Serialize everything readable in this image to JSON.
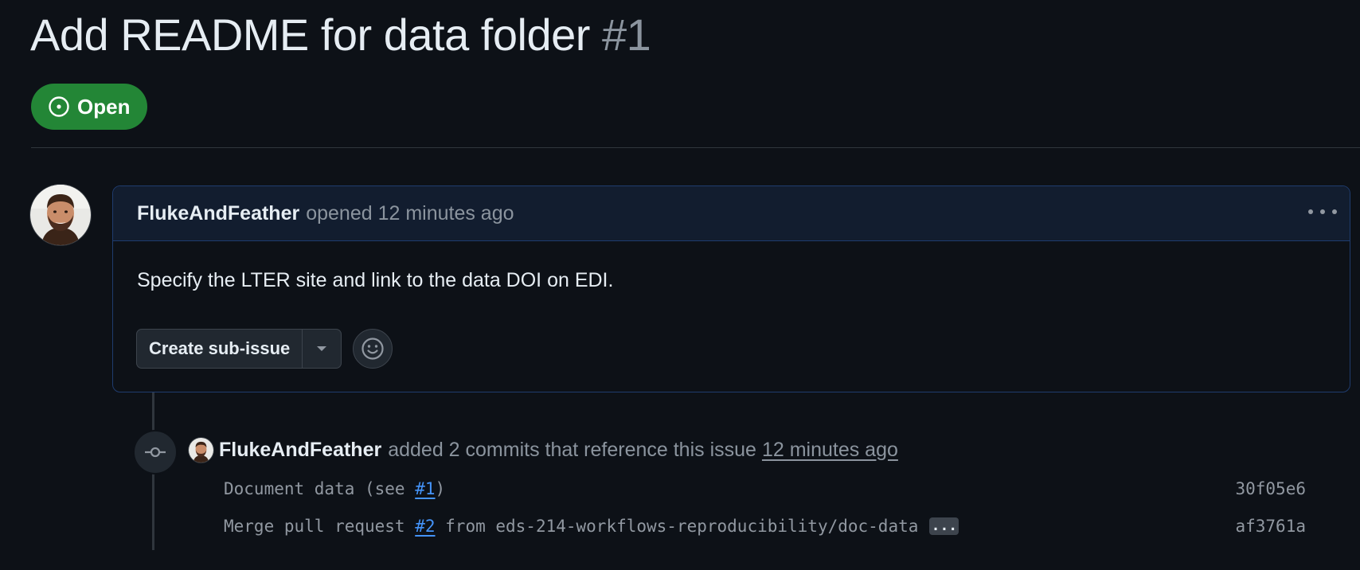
{
  "issue": {
    "title": "Add README for data folder",
    "number": "#1",
    "state": "Open"
  },
  "comment": {
    "author": "FlukeAndFeather",
    "meta": "opened 12 minutes ago",
    "body": "Specify the LTER site and link to the data DOI on EDI.",
    "create_sub_issue_label": "Create sub-issue"
  },
  "timeline": {
    "event": {
      "author": "FlukeAndFeather",
      "text": "added 2 commits that reference this issue",
      "time": "12 minutes ago"
    },
    "commits": [
      {
        "prefix": "Document data (see ",
        "ref": "#1",
        "suffix": ")",
        "sha": "30f05e6"
      },
      {
        "prefix": "Merge pull request ",
        "ref": "#2",
        "suffix": " from eds-214-workflows-reproducibility/doc-data",
        "sha": "af3761a",
        "more": "..."
      }
    ]
  },
  "icons": {
    "state": "issue-opened-icon",
    "kebab": "kebab-horizontal-icon",
    "dropdown": "triangle-down-icon",
    "reaction": "smiley-icon",
    "commit": "git-commit-icon"
  },
  "colors": {
    "background": "#0d1117",
    "open_badge": "#238636",
    "link": "#4493f8",
    "muted": "#8b949e",
    "comment_header": "#121d2f",
    "comment_border": "#1f3c6e"
  }
}
